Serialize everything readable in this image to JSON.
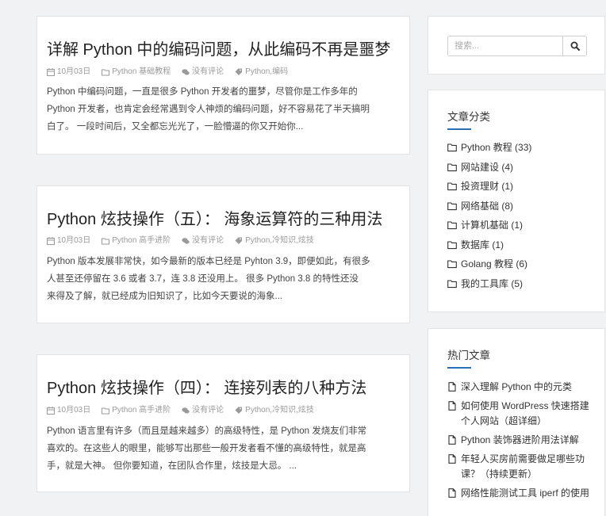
{
  "posts": [
    {
      "title": "详解 Python 中的编码问题，从此编码不再是噩梦",
      "date": "10月03日",
      "category": "Python 基础教程",
      "comments": "没有评论",
      "tags": "Python,编码",
      "excerpt": [
        "Python 中编码问题，一直是很多 Python 开发者的噩梦，尽管你是工作多年的",
        "Python 开发者，也肯定会经常遇到令人神烦的编码问题，好不容易花了半天搞明",
        "白了。 一段时间后，又全都忘光光了，一脸懵逼的你又开始你..."
      ]
    },
    {
      "title": "Python 炫技操作（五）： 海象运算符的三种用法",
      "date": "10月03日",
      "category": "Python 高手进阶",
      "comments": "没有评论",
      "tags": "Python,冷知识,炫技",
      "excerpt": [
        "Python 版本发展非常快，如今最新的版本已经是 Pyhton 3.9，即便如此，有很多",
        "人甚至还停留在 3.6 或者 3.7，连 3.8 还没用上。 很多 Python 3.8 的特性还没",
        "来得及了解，就已经成为旧知识了，比如今天要说的海象..."
      ]
    },
    {
      "title": "Python 炫技操作（四）： 连接列表的八种方法",
      "date": "10月03日",
      "category": "Python 高手进阶",
      "comments": "没有评论",
      "tags": "Python,冷知识,炫技",
      "excerpt": [
        "Python 语言里有许多（而且是越来越多）的高级特性，是 Python 发烧友们非常",
        "喜欢的。在这些人的眼里，能够写出那些一般开发者看不懂的高级特性，就是高",
        "手，就是大神。 但你要知道，在团队合作里，炫技是大忌。 ..."
      ]
    }
  ],
  "search": {
    "placeholder": "搜索..."
  },
  "categories": {
    "title": "文章分类",
    "items": [
      "Python 教程 (33)",
      "网站建设 (4)",
      "投资理财 (1)",
      "网络基础 (8)",
      "计算机基础 (1)",
      "数据库 (1)",
      "Golang 教程 (6)",
      "我的工具库 (5)"
    ]
  },
  "hot": {
    "title": "热门文章",
    "items": [
      "深入理解 Python 中的元类",
      "如何使用 WordPress 快速搭建个人网站（超详细）",
      "Python 装饰器进阶用法详解",
      "年轻人买房前需要做足哪些功课？（持续更新）",
      "网络性能测试工具 iperf 的使用"
    ]
  },
  "colors": {
    "accent": "#2a6fb4",
    "background": "#f1f2f4",
    "card": "#ffffff"
  }
}
